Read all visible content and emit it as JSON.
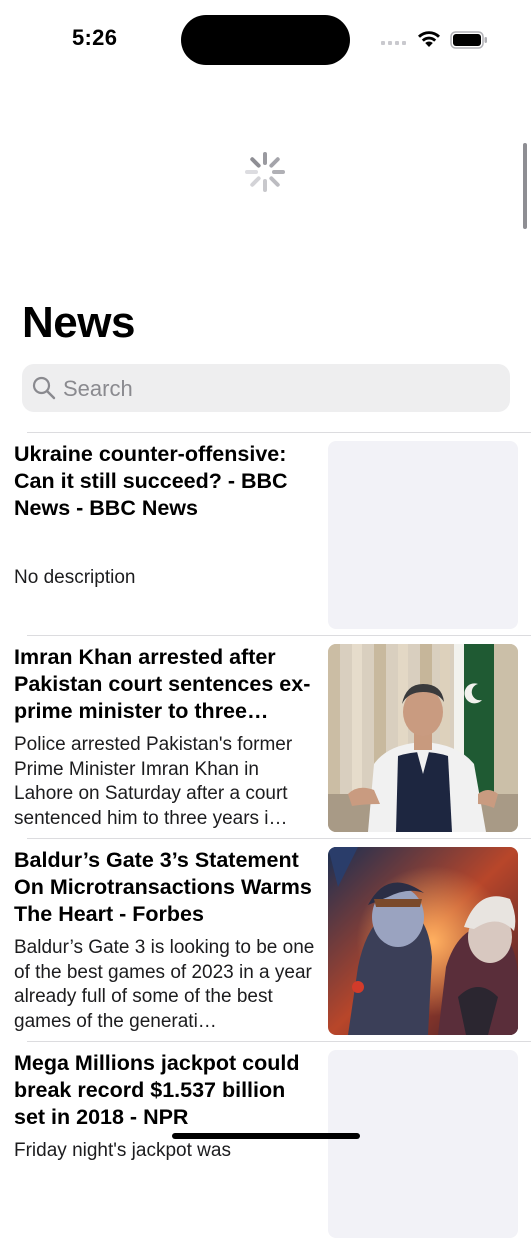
{
  "status_bar": {
    "time": "5:26"
  },
  "header": {
    "title": "News"
  },
  "search": {
    "placeholder": "Search"
  },
  "articles": [
    {
      "title": "Ukraine counter-offensive: Can it still succeed? - BBC News - BBC News",
      "description": "No description",
      "image": "placeholder"
    },
    {
      "title": "Imran Khan arrested after Pakistan court sentences ex-prime minister to three…",
      "description": "Police arrested Pakistan's former Prime Minister Imran Khan in Lahore on Saturday after a court sentenced him to three years i…",
      "image": "photo-man-seated-with-pakistan-flag"
    },
    {
      "title": "Baldur’s Gate 3’s Statement On Microtransactions Warms The Heart - Forbes",
      "description": "Baldur’s Gate 3 is looking to be one of the best games of 2023 in a year already full of some of the best games of the generati…",
      "image": "game-artwork-two-characters"
    },
    {
      "title": "Mega Millions jackpot could break record $1.537 billion set in 2018 - NPR",
      "description": "Friday night's jackpot was",
      "image": "placeholder"
    }
  ],
  "colors": {
    "placeholder_bg": "#f2f2f7",
    "search_bg": "#eeeeef",
    "separator": "#dcdcdf"
  }
}
